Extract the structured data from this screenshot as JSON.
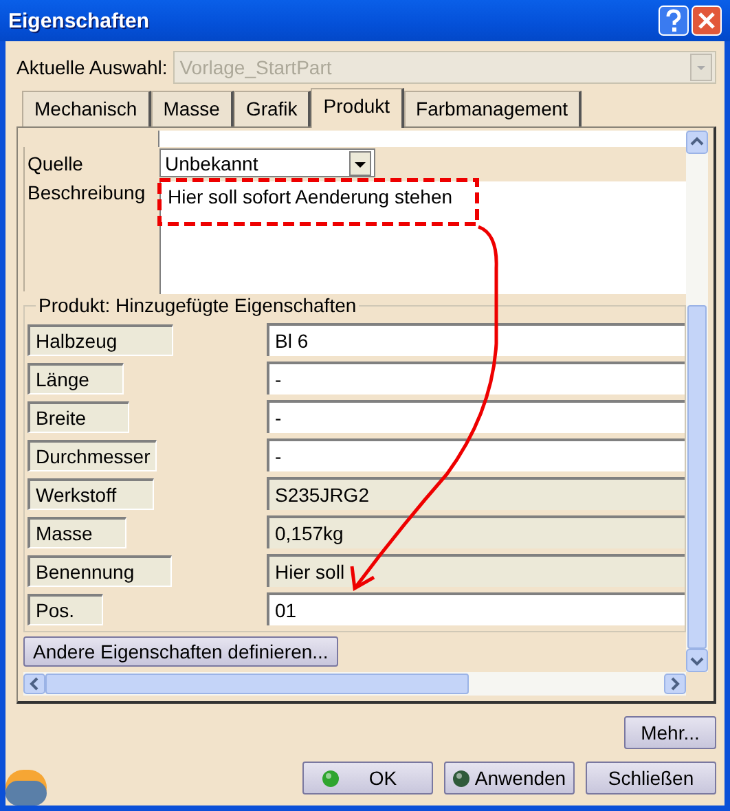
{
  "window": {
    "title": "Eigenschaften"
  },
  "selection": {
    "label": "Aktuelle Auswahl:",
    "value": "Vorlage_StartPart",
    "disabled": true
  },
  "tabs": [
    {
      "label": "Mechanisch",
      "selected": false
    },
    {
      "label": "Masse",
      "selected": false
    },
    {
      "label": "Grafik",
      "selected": false
    },
    {
      "label": "Produkt",
      "selected": true
    },
    {
      "label": "Farbmanagement",
      "selected": false
    }
  ],
  "fields": [
    {
      "label": "Quelle",
      "kind": "dropdown",
      "value": "Unbekannt"
    },
    {
      "label": "Beschreibung",
      "kind": "textarea",
      "value": "Hier soll sofort Aenderung stehen"
    }
  ],
  "group": {
    "title": "Produkt: Hinzugefügte Eigenschaften",
    "rows": [
      {
        "label": "Halbzeug",
        "value": "Bl 6",
        "disabled": false
      },
      {
        "label": "Länge",
        "value": "-",
        "disabled": false
      },
      {
        "label": "Breite",
        "value": "-",
        "disabled": false
      },
      {
        "label": "Durchmesser",
        "value": "-",
        "disabled": false
      },
      {
        "label": "Werkstoff",
        "value": "S235JRG2",
        "disabled": true
      },
      {
        "label": "Masse",
        "value": "0,157kg",
        "disabled": true
      },
      {
        "label": "Benennung",
        "value": "Hier soll",
        "disabled": true
      },
      {
        "label": "Pos.",
        "value": "01",
        "disabled": false
      }
    ]
  },
  "define_button": "Andere Eigenschaften definieren...",
  "more_button": "Mehr...",
  "buttons": [
    {
      "label": "OK",
      "kind": "ok"
    },
    {
      "label": "Anwenden",
      "kind": "apply"
    },
    {
      "label": "Schließen",
      "kind": "close"
    }
  ]
}
